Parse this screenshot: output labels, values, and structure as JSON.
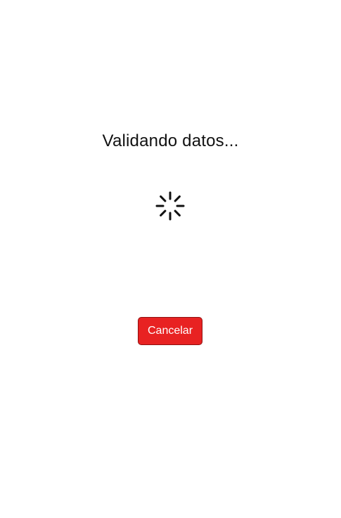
{
  "dialog": {
    "title": "Validando datos...",
    "spinner_icon": "loading-spinner-icon",
    "cancel_label": "Cancelar"
  },
  "colors": {
    "background": "#ffffff",
    "text": "#111111",
    "cancel_button": "#e82222",
    "cancel_button_border": "#8f1010",
    "spinner": "#111111"
  }
}
